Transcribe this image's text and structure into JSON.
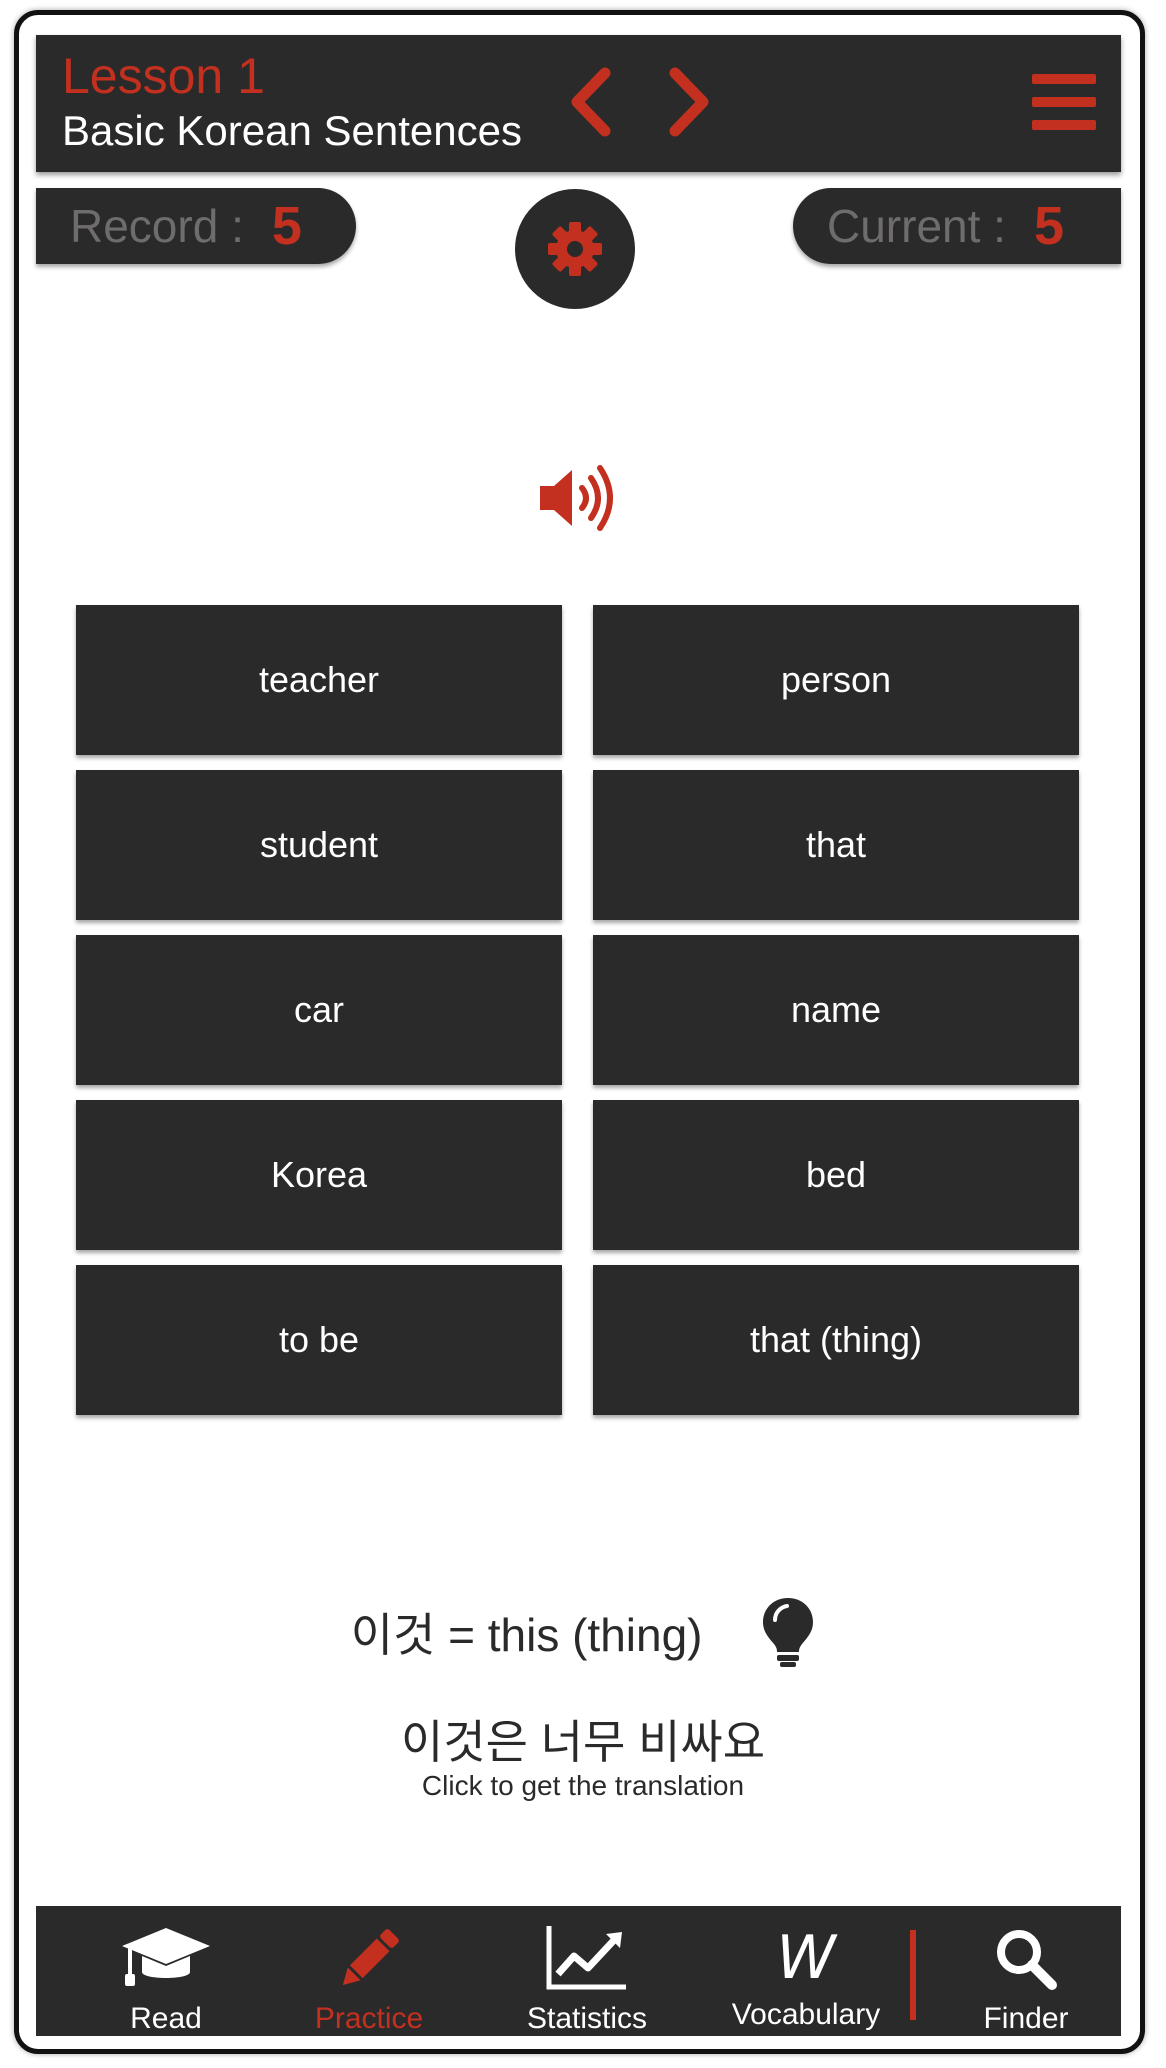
{
  "header": {
    "lesson_number": "Lesson 1",
    "lesson_title": "Basic Korean Sentences",
    "prev_icon": "chevron-left-icon",
    "next_icon": "chevron-right-icon",
    "menu_icon": "hamburger-menu-icon"
  },
  "scores": {
    "record_label": "Record :",
    "record_value": "5",
    "current_label": "Current :",
    "current_value": "5"
  },
  "settings_icon": "gear-icon",
  "audio_icon": "speaker-icon",
  "words": [
    "teacher",
    "person",
    "student",
    "that",
    "car",
    "name",
    "Korea",
    "bed",
    "to be",
    "that (thing)"
  ],
  "hint": {
    "text": "이것 = this (thing)",
    "icon": "lightbulb-icon"
  },
  "sentence": {
    "korean": "이것은 너무 비싸요",
    "translation_prompt": "Click to get the translation"
  },
  "nav": {
    "items": [
      {
        "label": "Read",
        "icon": "graduation-cap-icon",
        "active": false
      },
      {
        "label": "Practice",
        "icon": "pencil-icon",
        "active": true
      },
      {
        "label": "Statistics",
        "icon": "chart-icon",
        "active": false
      },
      {
        "label": "Vocabulary",
        "icon": "w-letter-icon",
        "active": false
      },
      {
        "label": "Finder",
        "icon": "search-icon",
        "active": false
      }
    ]
  },
  "colors": {
    "accent": "#c4301f",
    "dark": "#2b2a2a",
    "background": "#ffffff"
  }
}
